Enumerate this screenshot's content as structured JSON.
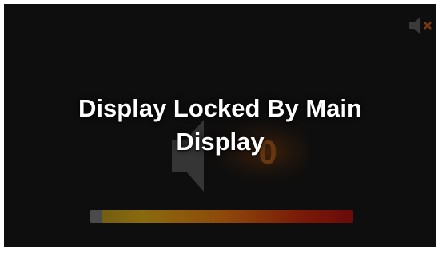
{
  "screen": {
    "message_line1": "Display Locked By Main",
    "message_line2": "Display"
  },
  "background_speaker": {
    "volume_digit": "0"
  },
  "volume": {
    "level": 1.0,
    "accent_color": "#c0392b"
  },
  "icons": {
    "top_right": "speaker-muted-icon",
    "background": "speaker-icon"
  }
}
